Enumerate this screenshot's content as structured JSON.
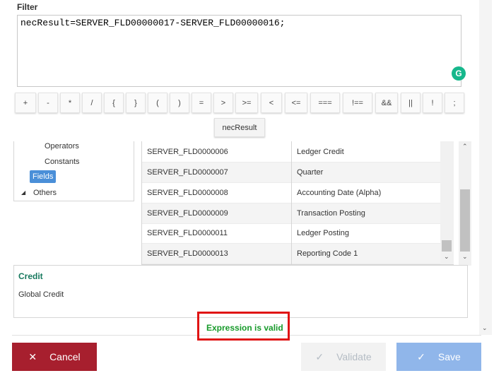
{
  "filter": {
    "label": "Filter",
    "expression": "necResult=SERVER_FLD00000017-SERVER_FLD00000016;"
  },
  "operators": [
    "+",
    "-",
    "*",
    "/",
    "{",
    "}",
    "(",
    ")",
    "=",
    ">",
    ">=",
    "<",
    "<=",
    "===",
    "!==",
    "&&",
    "||",
    "!",
    ";"
  ],
  "variable_chip": "necResult",
  "tree": {
    "items": [
      {
        "label": "Operators"
      },
      {
        "label": "Constants"
      },
      {
        "label": "Fields"
      },
      {
        "label": "Others"
      }
    ]
  },
  "fields_table": {
    "rows": [
      {
        "id": "SERVER_FLD0000006",
        "name": "Ledger Credit"
      },
      {
        "id": "SERVER_FLD0000007",
        "name": "Quarter"
      },
      {
        "id": "SERVER_FLD0000008",
        "name": "Accounting Date (Alpha)"
      },
      {
        "id": "SERVER_FLD0000009",
        "name": "Transaction Posting"
      },
      {
        "id": "SERVER_FLD0000011",
        "name": "Ledger Posting"
      },
      {
        "id": "SERVER_FLD0000013",
        "name": "Reporting Code 1"
      }
    ]
  },
  "description": {
    "title": "Credit",
    "text": "Global Credit"
  },
  "validation": {
    "message": "Expression is valid",
    "color": "#179a2a"
  },
  "actions": {
    "cancel_label": "Cancel",
    "validate_label": "Validate",
    "save_label": "Save"
  },
  "icons": {
    "cancel": "close-icon",
    "validate": "check-icon",
    "save": "check-icon",
    "grammarly": "grammarly-icon"
  },
  "colors": {
    "cancel": "#a71f2e",
    "save": "#90b6ea",
    "selected": "#4a8fd8",
    "highlight": "#e01414"
  }
}
